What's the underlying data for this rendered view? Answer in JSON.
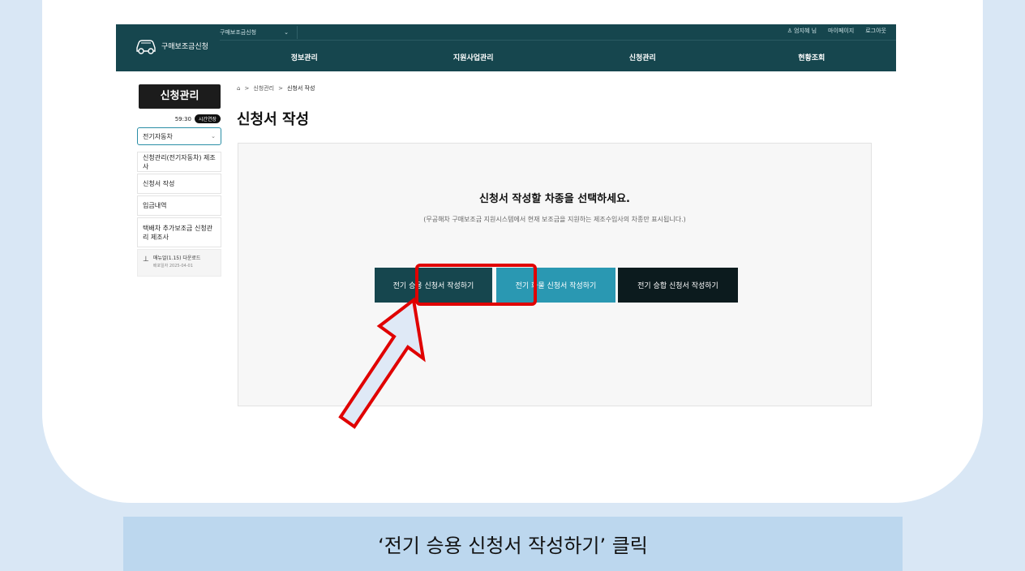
{
  "header": {
    "logo_text": "구매보조금신청",
    "service_select": "구매보조금신청",
    "user_name": "엄지혜 님",
    "mypage": "마이페이지",
    "logout": "로그아웃",
    "gnb": [
      "정보관리",
      "지원사업관리",
      "신청관리",
      "현황조회"
    ]
  },
  "sidebar": {
    "title": "신청관리",
    "timer": "59:30",
    "timer_extend": "시간연장",
    "vehicle_select": "전기자동차",
    "items": [
      "신청관리(전기자동차) 제조사",
      "신청서 작성",
      "입금내역",
      "택배차 추가보조금 신청관리 제조사"
    ],
    "download": {
      "label": "매뉴얼(1.15) 다운로드",
      "date": "배포일자 2025-04-01"
    }
  },
  "breadcrumb": {
    "level1": "신청관리",
    "level2": "신청서 작성"
  },
  "page_title": "신청서 작성",
  "panel": {
    "heading": "신청서 작성할 차종을 선택하세요.",
    "sub": "(무공해차 구매보조금 지원시스템에서 현재 보조금을 지원하는 제조수입사의 차종만 표시됩니다.)",
    "buttons": [
      "전기 승용 신청서 작성하기",
      "전기 화물 신청서 작성하기",
      "전기 승합 신청서 작성하기"
    ]
  },
  "caption": "‘전기 승용 신청서 작성하기’ 클릭",
  "colors": {
    "nav": "#16464e",
    "truck_button": "#2a98b2",
    "van_button": "#0c1b1e",
    "highlight": "#e00000",
    "caption_bg": "#bcd7ee"
  }
}
